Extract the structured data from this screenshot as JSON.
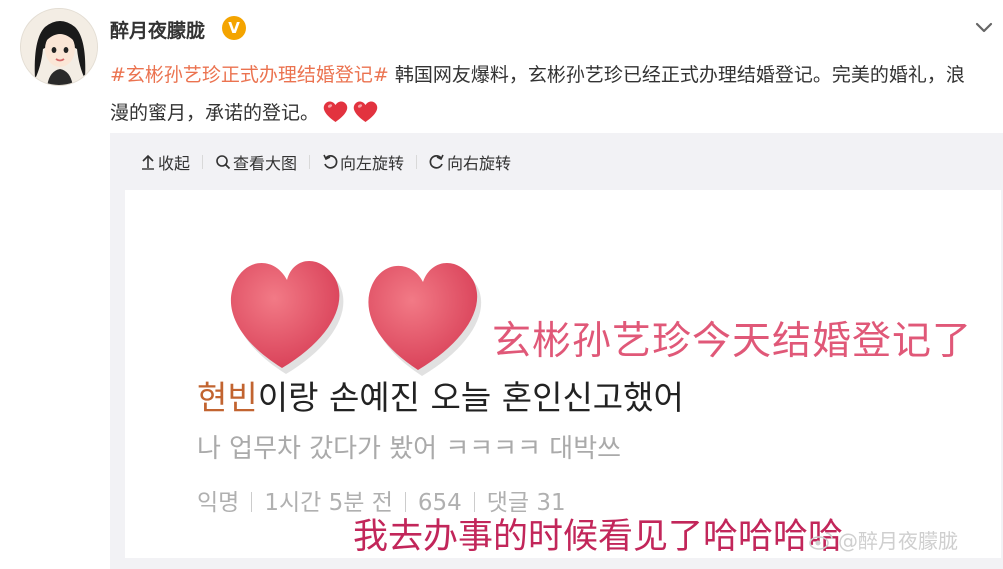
{
  "post": {
    "username": "醉月夜朦胧",
    "verified_badge": "V",
    "hashtag": "#玄彬孙艺珍正式办理结婚登记#",
    "text": " 韩国网友爆料，玄彬孙艺珍已经正式办理结婚登记。完美的婚礼，浪漫的蜜月，承诺的登记。",
    "emoji": "heart-emoji"
  },
  "toolbar": {
    "collapse": "收起",
    "view_large": "查看大图",
    "rotate_left": "向左旋转",
    "rotate_right": "向右旋转"
  },
  "picture": {
    "headline": "玄彬孙艺珍今天结婚登记了",
    "line1_name": "현빈",
    "line1_rest": "이랑 손예진 오늘 혼인신고했어",
    "line2": "나 업무차 갔다가 봤어 ㅋㅋㅋㅋ 대박쓰",
    "meta": [
      "익명",
      "1시간 5분 전",
      "654",
      "댓글 31"
    ],
    "caption": "我去办事的时候看见了哈哈哈哈",
    "watermark": "@醉月夜朦胧"
  },
  "colors": {
    "hashtag": "#eb7350",
    "heart": "#e55a6c",
    "verified": "#f4a400"
  }
}
